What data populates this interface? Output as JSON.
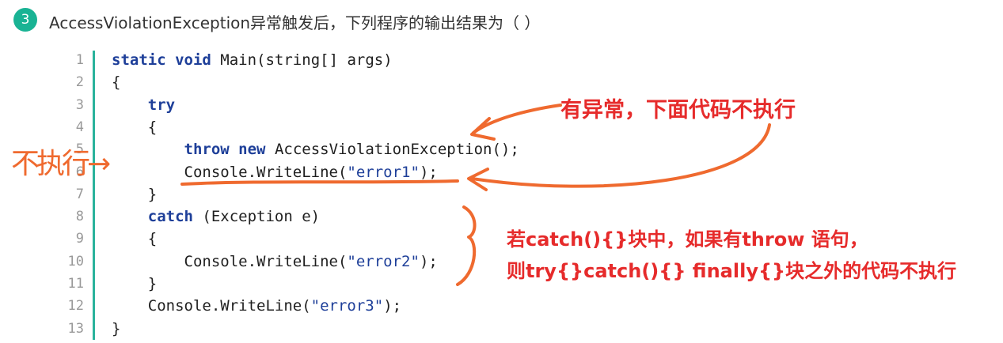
{
  "question": {
    "number": "3",
    "text": "AccessViolationException异常触发后，下列程序的输出结果为（      ）"
  },
  "code_lines": [
    {
      "num": "1",
      "tokens": [
        {
          "t": "static",
          "c": "kw"
        },
        {
          "t": " "
        },
        {
          "t": "void",
          "c": "kw"
        },
        {
          "t": " Main(string[] args)"
        }
      ]
    },
    {
      "num": "2",
      "tokens": [
        {
          "t": "{"
        }
      ]
    },
    {
      "num": "3",
      "tokens": [
        {
          "t": "    "
        },
        {
          "t": "try",
          "c": "kw"
        }
      ]
    },
    {
      "num": "4",
      "tokens": [
        {
          "t": "    {"
        }
      ]
    },
    {
      "num": "5",
      "tokens": [
        {
          "t": "        "
        },
        {
          "t": "throw",
          "c": "kw"
        },
        {
          "t": " "
        },
        {
          "t": "new",
          "c": "kw"
        },
        {
          "t": " AccessViolationException();"
        }
      ]
    },
    {
      "num": "6",
      "tokens": [
        {
          "t": "        Console.WriteLine("
        },
        {
          "t": "\"error1\"",
          "c": "str"
        },
        {
          "t": ");"
        }
      ]
    },
    {
      "num": "7",
      "tokens": [
        {
          "t": "    }"
        }
      ]
    },
    {
      "num": "8",
      "tokens": [
        {
          "t": "    "
        },
        {
          "t": "catch",
          "c": "kw"
        },
        {
          "t": " (Exception e)"
        }
      ]
    },
    {
      "num": "9",
      "tokens": [
        {
          "t": "    {"
        }
      ]
    },
    {
      "num": "10",
      "tokens": [
        {
          "t": "        Console.WriteLine("
        },
        {
          "t": "\"error2\"",
          "c": "str"
        },
        {
          "t": ");"
        }
      ]
    },
    {
      "num": "11",
      "tokens": [
        {
          "t": "    }"
        }
      ]
    },
    {
      "num": "12",
      "tokens": [
        {
          "t": "    Console.WriteLine("
        },
        {
          "t": "\"error3\"",
          "c": "str"
        },
        {
          "t": ");"
        }
      ]
    },
    {
      "num": "13",
      "tokens": [
        {
          "t": "}"
        }
      ]
    }
  ],
  "annotations": {
    "no_exec_below": "有异常，下面代码不执行",
    "catch_note_1": "若catch(){}块中，如果有throw 语句，",
    "catch_note_2": "则try{}catch(){} finally{}块之外的代码不执行",
    "handwritten_label": "不执行→"
  },
  "colors": {
    "badge": "#19b394",
    "gutter": "#2ab39c",
    "keyword": "#1e3f99",
    "annotation_red": "#e62b2b",
    "handwriting_orange": "#ef6a2f"
  }
}
